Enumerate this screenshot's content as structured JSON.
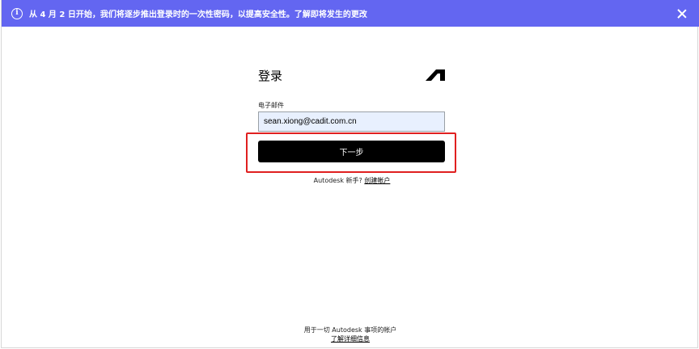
{
  "banner": {
    "icon": "info-icon",
    "text": "从 4 月 2 日开始，我们将逐步推出登录时的一次性密码，以提高安全性。了解即将发生的更改",
    "close_icon": "close-icon",
    "color": "#6366f1"
  },
  "signin": {
    "title": "登录",
    "logo_icon": "autodesk-logo-icon",
    "email_label": "电子邮件",
    "email_value": "sean.xiong@cadit.com.cn",
    "next_label": "下一步",
    "new_user_text": "Autodesk 新手?",
    "create_account_label": "创建帐户"
  },
  "footer": {
    "line1": "用于一切 Autodesk 事项的帐户",
    "learn_more_label": "了解详细信息"
  },
  "highlight_color": "#e02020"
}
